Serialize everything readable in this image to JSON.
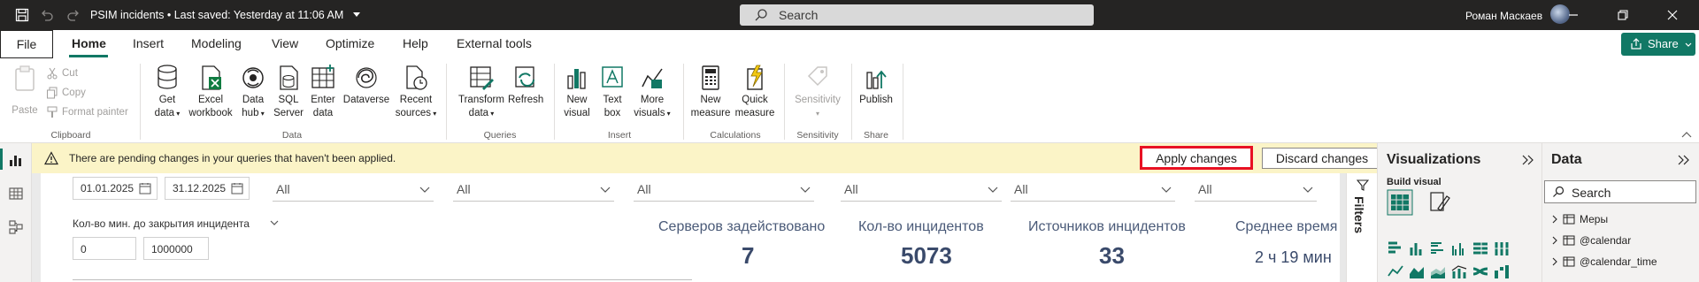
{
  "titlebar": {
    "title": "PSIM incidents • Last saved: Yesterday at 11:06 AM",
    "search_placeholder": "Search",
    "user_name": "Роман Маскаев",
    "icons": [
      "save-icon",
      "undo-icon",
      "redo-icon",
      "dropdown-icon",
      "search-icon",
      "minimize-icon",
      "restore-icon",
      "close-icon"
    ]
  },
  "menu": {
    "file": "File",
    "tabs": [
      "Home",
      "Insert",
      "Modeling",
      "View",
      "Optimize",
      "Help",
      "External tools"
    ],
    "active_tab": "Home",
    "share": "Share"
  },
  "ribbon": {
    "clipboard": {
      "paste": "Paste",
      "cut": "Cut",
      "copy": "Copy",
      "format_painter": "Format painter",
      "group": "Clipboard"
    },
    "data": {
      "get_data_1": "Get",
      "get_data_2": "data",
      "excel_1": "Excel",
      "excel_2": "workbook",
      "hub_1": "Data",
      "hub_2": "hub",
      "sql_1": "SQL",
      "sql_2": "Server",
      "enter_1": "Enter",
      "enter_2": "data",
      "dataverse": "Dataverse",
      "recent_1": "Recent",
      "recent_2": "sources",
      "group": "Data"
    },
    "queries": {
      "transform_1": "Transform",
      "transform_2": "data",
      "refresh": "Refresh",
      "group": "Queries"
    },
    "insert": {
      "new_visual_1": "New",
      "new_visual_2": "visual",
      "text_box_1": "Text",
      "text_box_2": "box",
      "more_1": "More",
      "more_2": "visuals",
      "group": "Insert"
    },
    "calculations": {
      "new_measure_1": "New",
      "new_measure_2": "measure",
      "quick_1": "Quick",
      "quick_2": "measure",
      "group": "Calculations"
    },
    "sensitivity": {
      "label": "Sensitivity",
      "group": "Sensitivity"
    },
    "share": {
      "publish": "Publish",
      "group": "Share"
    }
  },
  "warning": {
    "text": "There are pending changes in your queries that haven't been applied.",
    "apply": "Apply changes",
    "discard": "Discard changes"
  },
  "report": {
    "date_from": "01.01.2025",
    "date_to": "31.12.2025",
    "slicers": [
      "All",
      "All",
      "All",
      "All",
      "All",
      "All"
    ],
    "range_label": "Кол-во мин. до закрытия инцидента",
    "range_min": "0",
    "range_max": "1000000",
    "kpis": [
      {
        "label": "Серверов задействовано",
        "value": "7"
      },
      {
        "label": "Кол-во инцидентов",
        "value": "5073"
      },
      {
        "label": "Источников инцидентов",
        "value": "33"
      },
      {
        "label": "Среднее время",
        "value": "2 ч 19 мин"
      }
    ]
  },
  "filters": {
    "label": "Filters"
  },
  "visualizations": {
    "title": "Visualizations",
    "build_visual": "Build visual"
  },
  "data_pane": {
    "title": "Data",
    "search_placeholder": "Search",
    "items": [
      "Меры",
      "@calendar",
      "@calendar_time"
    ]
  },
  "colors": {
    "accent": "#117865",
    "titlebar": "#252423",
    "warning_bg": "#fbf4c7",
    "highlight_border": "#e81123",
    "kpi_text": "#3a4a6b"
  }
}
